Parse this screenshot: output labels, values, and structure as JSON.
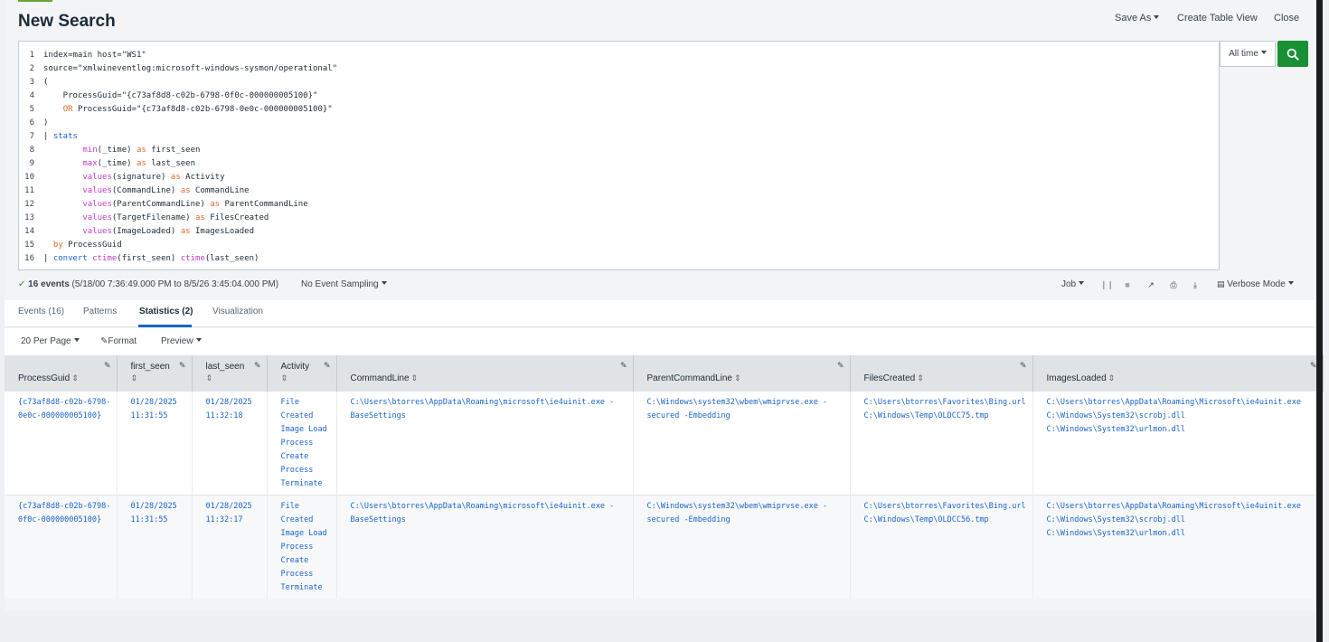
{
  "header": {
    "title": "New Search",
    "save_as": "Save As",
    "create_table_view": "Create Table View",
    "close": "Close"
  },
  "editor": {
    "line_numbers": [
      "1",
      "2",
      "3",
      "4",
      "5",
      "6",
      "7",
      "8",
      "9",
      "10",
      "11",
      "12",
      "13",
      "14",
      "15",
      "16"
    ],
    "lines": [
      [
        {
          "t": "index=main host=\"WS1\"",
          "c": "plain"
        }
      ],
      [
        {
          "t": "source=\"xmlwineventlog:microsoft-windows-sysmon/operational\"",
          "c": "plain"
        }
      ],
      [
        {
          "t": "(",
          "c": "plain"
        }
      ],
      [
        {
          "t": "    ProcessGuid=\"{c73af8d8-c02b-6798-0f0c-000000005100}\"",
          "c": "plain"
        }
      ],
      [
        {
          "t": "    ",
          "c": "plain"
        },
        {
          "t": "OR",
          "c": "op"
        },
        {
          "t": " ProcessGuid=\"{c73af8d8-c02b-6798-0e0c-000000005100}\"",
          "c": "plain"
        }
      ],
      [
        {
          "t": ")",
          "c": "plain"
        }
      ],
      [
        {
          "t": "| ",
          "c": "plain"
        },
        {
          "t": "stats",
          "c": "cmd"
        }
      ],
      [
        {
          "t": "        ",
          "c": "plain"
        },
        {
          "t": "min",
          "c": "fn"
        },
        {
          "t": "(_time) ",
          "c": "plain"
        },
        {
          "t": "as",
          "c": "op"
        },
        {
          "t": " first_seen",
          "c": "plain"
        }
      ],
      [
        {
          "t": "        ",
          "c": "plain"
        },
        {
          "t": "max",
          "c": "fn"
        },
        {
          "t": "(_time) ",
          "c": "plain"
        },
        {
          "t": "as",
          "c": "op"
        },
        {
          "t": " last_seen",
          "c": "plain"
        }
      ],
      [
        {
          "t": "        ",
          "c": "plain"
        },
        {
          "t": "values",
          "c": "fn"
        },
        {
          "t": "(signature) ",
          "c": "plain"
        },
        {
          "t": "as",
          "c": "op"
        },
        {
          "t": " Activity",
          "c": "plain"
        }
      ],
      [
        {
          "t": "        ",
          "c": "plain"
        },
        {
          "t": "values",
          "c": "fn"
        },
        {
          "t": "(CommandLine) ",
          "c": "plain"
        },
        {
          "t": "as",
          "c": "op"
        },
        {
          "t": " CommandLine",
          "c": "plain"
        }
      ],
      [
        {
          "t": "        ",
          "c": "plain"
        },
        {
          "t": "values",
          "c": "fn"
        },
        {
          "t": "(ParentCommandLine) ",
          "c": "plain"
        },
        {
          "t": "as",
          "c": "op"
        },
        {
          "t": " ParentCommandLine",
          "c": "plain"
        }
      ],
      [
        {
          "t": "        ",
          "c": "plain"
        },
        {
          "t": "values",
          "c": "fn"
        },
        {
          "t": "(TargetFilename) ",
          "c": "plain"
        },
        {
          "t": "as",
          "c": "op"
        },
        {
          "t": " FilesCreated",
          "c": "plain"
        }
      ],
      [
        {
          "t": "        ",
          "c": "plain"
        },
        {
          "t": "values",
          "c": "fn"
        },
        {
          "t": "(ImageLoaded) ",
          "c": "plain"
        },
        {
          "t": "as",
          "c": "op"
        },
        {
          "t": " ImagesLoaded",
          "c": "plain"
        }
      ],
      [
        {
          "t": "  ",
          "c": "plain"
        },
        {
          "t": "by",
          "c": "op"
        },
        {
          "t": " ProcessGuid",
          "c": "plain"
        }
      ],
      [
        {
          "t": "| ",
          "c": "plain"
        },
        {
          "t": "convert",
          "c": "cmd"
        },
        {
          "t": " ",
          "c": "plain"
        },
        {
          "t": "ctime",
          "c": "fn"
        },
        {
          "t": "(first_seen) ",
          "c": "plain"
        },
        {
          "t": "ctime",
          "c": "fn"
        },
        {
          "t": "(last_seen)",
          "c": "plain"
        }
      ]
    ]
  },
  "time_picker": {
    "label": "All time"
  },
  "status": {
    "check": "✓",
    "events": "16 events",
    "range": "(5/18/00 7:36:49.000 PM to 8/5/26 3:45:04.000 PM)",
    "sampling": "No Event Sampling",
    "job": "Job",
    "mode": "Verbose Mode"
  },
  "tabs": [
    "Events (16)",
    "Patterns",
    "Statistics (2)",
    "Visualization"
  ],
  "toolbar": {
    "per_page": "20 Per Page",
    "format": "Format",
    "preview": "Preview"
  },
  "table": {
    "columns": [
      "ProcessGuid",
      "first_seen",
      "last_seen",
      "Activity",
      "CommandLine",
      "ParentCommandLine",
      "FilesCreated",
      "ImagesLoaded"
    ],
    "rows": [
      [
        "{c73af8d8-c02b-6798-\n0e0c-000000005100}",
        "01/28/2025\n11:31:55",
        "01/28/2025\n11:32:18",
        "File\nCreated\nImage Load\nProcess\nCreate\nProcess\nTerminate",
        "C:\\Users\\btorres\\AppData\\Roaming\\microsoft\\ie4uinit.exe -\nBaseSettings",
        "C:\\Windows\\system32\\wbem\\wmiprvse.exe -\nsecured -Embedding",
        "C:\\Users\\btorres\\Favorites\\Bing.url\nC:\\Windows\\Temp\\OLDCC75.tmp",
        "C:\\Users\\btorres\\AppData\\Roaming\\Microsoft\\ie4uinit.exe\nC:\\Windows\\System32\\scrobj.dll\nC:\\Windows\\System32\\urlmon.dll"
      ],
      [
        "{c73af8d8-c02b-6798-\n0f0c-000000005100}",
        "01/28/2025\n11:31:55",
        "01/28/2025\n11:32:17",
        "File\nCreated\nImage Load\nProcess\nCreate\nProcess\nTerminate",
        "C:\\Users\\btorres\\AppData\\Roaming\\microsoft\\ie4uinit.exe -\nBaseSettings",
        "C:\\Windows\\system32\\wbem\\wmiprvse.exe -\nsecured -Embedding",
        "C:\\Users\\btorres\\Favorites\\Bing.url\nC:\\Windows\\Temp\\OLDCC56.tmp",
        "C:\\Users\\btorres\\AppData\\Roaming\\Microsoft\\ie4uinit.exe\nC:\\Windows\\System32\\scrobj.dll\nC:\\Windows\\System32\\urlmon.dll"
      ]
    ]
  },
  "colors": {
    "accent_green": "#1a9035",
    "link_blue": "#1a64c9",
    "header_gray": "#dfe3e6"
  },
  "icons": [
    "search-icon",
    "pause-icon",
    "stop-icon",
    "share-icon",
    "print-icon",
    "download-icon",
    "verbose-mode-icon",
    "pencil-icon",
    "sort-icon"
  ]
}
